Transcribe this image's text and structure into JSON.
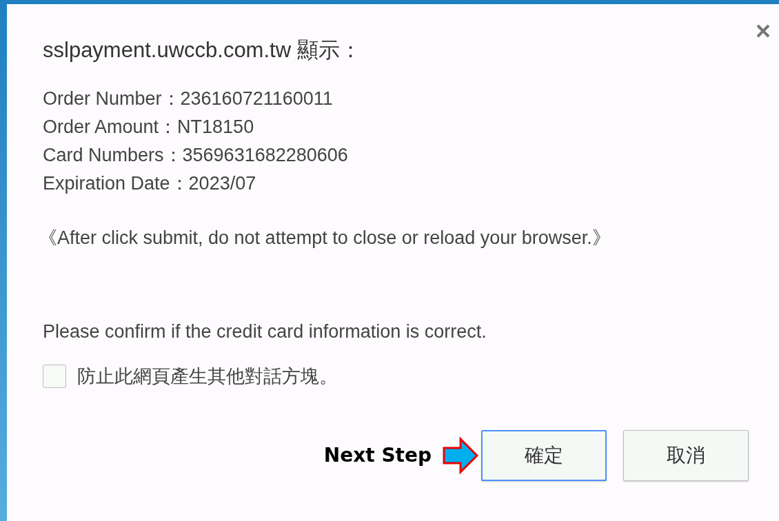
{
  "dialog": {
    "title": "sslpayment.uwccb.com.tw 顯示：",
    "lines": [
      "Order Number：236160721160011",
      "Order Amount：NT18150",
      "Card Numbers：3569631682280606",
      "Expiration Date：2023/07"
    ],
    "notice": "《After click submit, do not attempt to close or reload your browser.》",
    "question": "Please confirm if the credit card information is correct.",
    "suppress": {
      "label": "防止此網頁產生其他對話方塊。",
      "checked": false
    },
    "hint": "Next Step",
    "buttons": [
      {
        "label": "確定",
        "focused": true
      },
      {
        "label": "取消",
        "focused": false
      }
    ]
  }
}
